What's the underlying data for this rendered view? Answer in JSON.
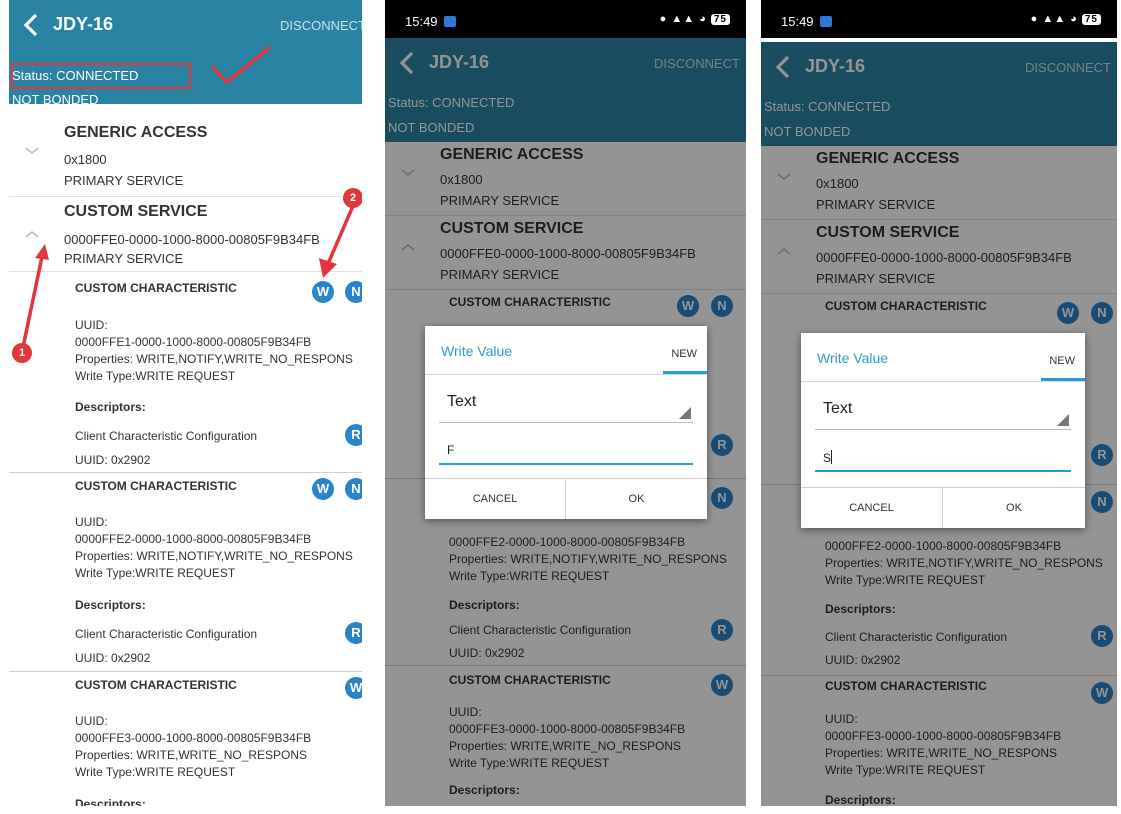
{
  "colors": {
    "appbar": "#2b83a3",
    "badge": "#2b83c8",
    "accent": "#2b9bd6",
    "annotation": "#e2363d"
  },
  "device": {
    "title": "JDY-16",
    "disconnect_label": "DISCONNECT",
    "status": "Status: CONNECTED",
    "bond": "NOT BONDED"
  },
  "status_bar": {
    "time": "15:49",
    "battery": "75"
  },
  "services": [
    {
      "name": "GENERIC ACCESS",
      "uuid": "0x1800",
      "type": "PRIMARY SERVICE"
    },
    {
      "name": "CUSTOM SERVICE",
      "uuid": "0000FFE0-0000-1000-8000-00805F9B34FB",
      "type": "PRIMARY SERVICE"
    }
  ],
  "characteristics": [
    {
      "name": "CUSTOM CHARACTERISTIC",
      "uuid_label": "UUID:",
      "uuid": "0000FFE1-0000-1000-8000-00805F9B34FB",
      "properties": "Properties: WRITE,NOTIFY,WRITE_NO_RESPONS",
      "write_type": "Write Type:WRITE REQUEST",
      "descriptors_label": "Descriptors:",
      "descriptor": "Client Characteristic Configuration",
      "descriptor_uuid": "UUID: 0x2902",
      "badges": [
        "W",
        "N"
      ],
      "descriptor_badge": "R"
    },
    {
      "name": "CUSTOM CHARACTERISTIC",
      "uuid_label": "UUID:",
      "uuid": "0000FFE2-0000-1000-8000-00805F9B34FB",
      "properties": "Properties: WRITE,NOTIFY,WRITE_NO_RESPONS",
      "write_type": "Write Type:WRITE REQUEST",
      "descriptors_label": "Descriptors:",
      "descriptor": "Client Characteristic Configuration",
      "descriptor_uuid": "UUID: 0x2902",
      "badges": [
        "W",
        "N"
      ],
      "descriptor_badge": "R"
    },
    {
      "name": "CUSTOM CHARACTERISTIC",
      "uuid_label": "UUID:",
      "uuid": "0000FFE3-0000-1000-8000-00805F9B34FB",
      "properties": "Properties: WRITE,WRITE_NO_RESPONS",
      "write_type": "Write Type:WRITE REQUEST",
      "descriptors_label": "Descriptors:",
      "badges": [
        "W"
      ]
    }
  ],
  "dialogs": [
    {
      "title": "Write Value",
      "tab": "NEW",
      "type": "Text",
      "value": "F",
      "cancel": "CANCEL",
      "ok": "OK"
    },
    {
      "title": "Write Value",
      "tab": "NEW",
      "type": "Text",
      "value": "S",
      "cancel": "CANCEL",
      "ok": "OK"
    }
  ],
  "annotations": {
    "step1": "1",
    "step2": "2"
  }
}
